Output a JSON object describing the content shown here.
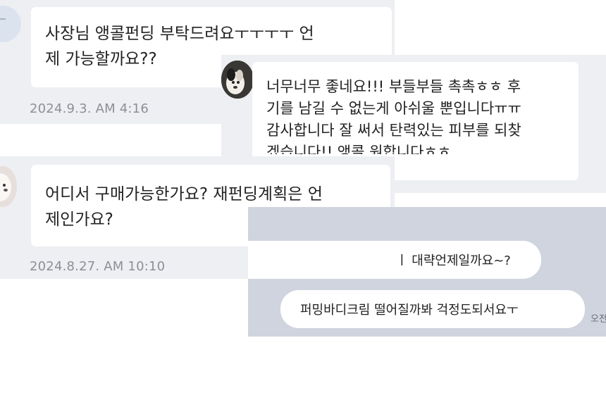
{
  "review_1": {
    "message_line1": "사장님 앵콜펀딩 부탁드려요ㅜㅜㅜㅜ 언",
    "message_line2": "제 가능할까요??",
    "date": "2024.9.3. AM 4:16"
  },
  "review_2": {
    "message_line1": "너무너무 좋네요!!! 부들부들 촉촉ㅎㅎ 후",
    "message_line2": "기를 남길 수 없는게 아쉬울 뿐입니다ㅠㅠ",
    "message_line3": "감사합니다 잘 써서 탄력있는 피부를 되찾",
    "message_line4": "겠습니다!! 앵콜 원합니다ㅎㅎ"
  },
  "review_3": {
    "message_line1": "어디서 구매가능한가요? 재펀딩계획은 언",
    "message_line2": "제인가요?",
    "date": "2024.8.27. AM 10:10"
  },
  "chat": {
    "bubble_1": "ㅣ 대략언제일까요~?",
    "bubble_2": "퍼밍바디크림 떨어질까봐 걱정도되서요ㅜ",
    "time_partial": "오전"
  }
}
